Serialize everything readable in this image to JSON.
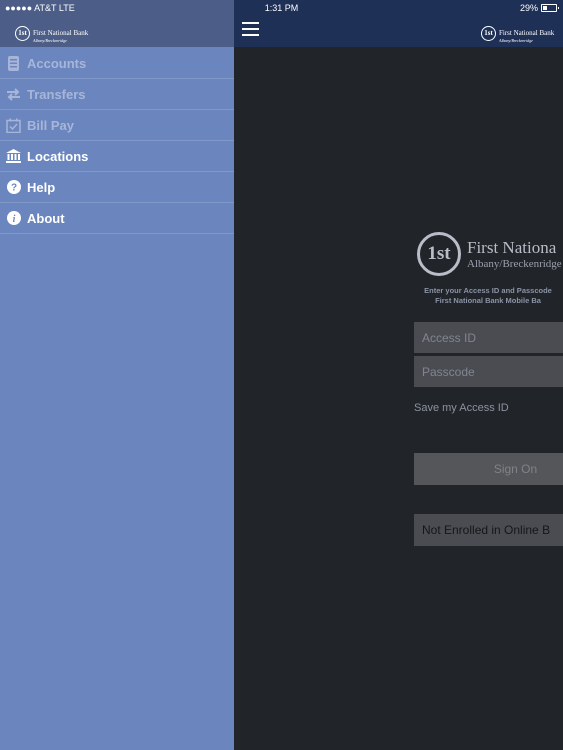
{
  "status_bar": {
    "carrier": "●●●●● AT&T  LTE",
    "time": "1:31 PM",
    "battery": "29%",
    "battery_level": 0.29
  },
  "brand": {
    "logo_mark": "1st",
    "name": "First National Bank",
    "location": "Albany/Breckenridge"
  },
  "login_brand": {
    "name": "First Nationa",
    "location": "Albany/Breckenridge"
  },
  "sidebar": {
    "items": [
      {
        "label": "Accounts",
        "icon": "accounts-icon"
      },
      {
        "label": "Transfers",
        "icon": "transfers-icon"
      },
      {
        "label": "Bill Pay",
        "icon": "bill-pay-icon"
      },
      {
        "label": "Locations",
        "icon": "bank-building-icon"
      },
      {
        "label": "Help",
        "icon": "help-icon"
      },
      {
        "label": "About",
        "icon": "info-icon"
      }
    ]
  },
  "login": {
    "instructions_line1": "Enter your Access ID and Passcode",
    "instructions_line2": "First National Bank Mobile Ba",
    "access_id_placeholder": "Access ID",
    "passcode_placeholder": "Passcode",
    "save_access_id": "Save my Access ID",
    "sign_on": "Sign On",
    "not_enrolled": "Not Enrolled in Online B"
  },
  "colors": {
    "sidebar_bg": "#6b86be",
    "top_bar_bg": "#1f3057",
    "content_bg": "#212429"
  }
}
